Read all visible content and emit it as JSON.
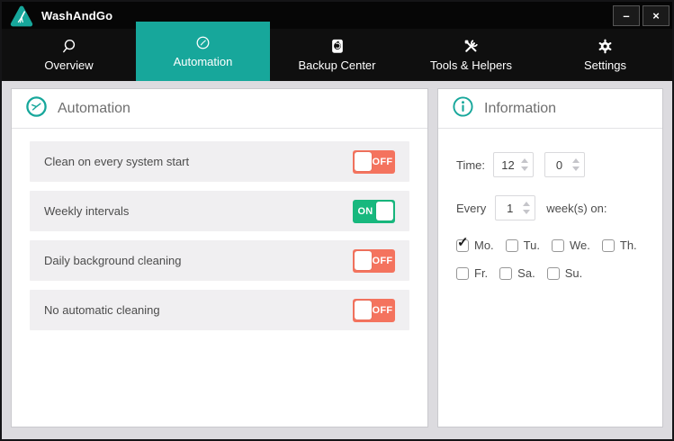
{
  "window": {
    "title": "WashAndGo",
    "minimize_glyph": "–",
    "close_glyph": "×"
  },
  "tabs": [
    {
      "label": "Overview",
      "icon": "search-icon",
      "active": false
    },
    {
      "label": "Automation",
      "icon": "clock-icon",
      "active": true
    },
    {
      "label": "Backup Center",
      "icon": "backup-icon",
      "active": false
    },
    {
      "label": "Tools & Helpers",
      "icon": "tools-icon",
      "active": false
    },
    {
      "label": "Settings",
      "icon": "gear-icon",
      "active": false
    }
  ],
  "automation_panel": {
    "title": "Automation",
    "rows": [
      {
        "label": "Clean on every system start",
        "state": "OFF"
      },
      {
        "label": "Weekly intervals",
        "state": "ON"
      },
      {
        "label": "Daily background cleaning",
        "state": "OFF"
      },
      {
        "label": "No automatic cleaning",
        "state": "OFF"
      }
    ]
  },
  "information_panel": {
    "title": "Information",
    "time_label": "Time:",
    "time_hour": "12",
    "time_minute": "0",
    "every_label": "Every",
    "interval_value": "1",
    "interval_suffix": "week(s) on:",
    "days": [
      {
        "label": "Mo.",
        "checked": true
      },
      {
        "label": "Tu.",
        "checked": false
      },
      {
        "label": "We.",
        "checked": false
      },
      {
        "label": "Th.",
        "checked": false
      },
      {
        "label": "Fr.",
        "checked": false
      },
      {
        "label": "Sa.",
        "checked": false
      },
      {
        "label": "Su.",
        "checked": false
      }
    ]
  },
  "icons": {
    "checkmark": "✓"
  },
  "colors": {
    "accent_teal": "#17a79b",
    "toggle_on": "#18b87e",
    "toggle_off": "#f4735e",
    "titlebar": "#060606",
    "tabbar": "#0f0f0f",
    "content_bg": "#dcdbdf",
    "row_bg": "#f0eff1"
  }
}
